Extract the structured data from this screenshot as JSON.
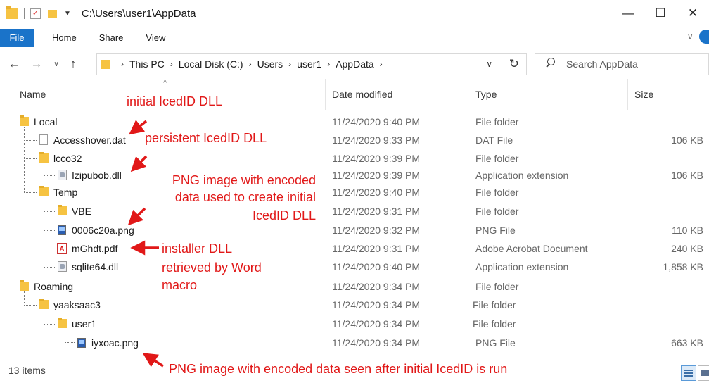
{
  "window": {
    "title": "C:\\Users\\user1\\AppData",
    "minimize": "—",
    "maximize": "☐",
    "close": "✕"
  },
  "ribbon": {
    "tabs": [
      "File",
      "Home",
      "Share",
      "View"
    ]
  },
  "nav": {
    "breadcrumbs": [
      "This PC",
      "Local Disk (C:)",
      "Users",
      "user1",
      "AppData"
    ],
    "search_placeholder": "Search AppData"
  },
  "columns": {
    "name": "Name",
    "date": "Date modified",
    "type": "Type",
    "size": "Size"
  },
  "rows": [
    {
      "name": "Local",
      "date": "11/24/2020 9:40 PM",
      "type": "File folder",
      "size": "",
      "icon": "folder-icon",
      "level": 0
    },
    {
      "name": "Accesshover.dat",
      "date": "11/24/2020 9:33 PM",
      "type": "DAT File",
      "size": "106 KB",
      "icon": "file-icon",
      "level": 1
    },
    {
      "name": "lcco32",
      "date": "11/24/2020 9:39 PM",
      "type": "File folder",
      "size": "",
      "icon": "folder-icon",
      "level": 1
    },
    {
      "name": "Izipubob.dll",
      "date": "11/24/2020 9:39 PM",
      "type": "Application extension",
      "size": "106 KB",
      "icon": "dll-icon",
      "level": 2
    },
    {
      "name": "Temp",
      "date": "11/24/2020 9:40 PM",
      "type": "File folder",
      "size": "",
      "icon": "folder-icon",
      "level": 1
    },
    {
      "name": "VBE",
      "date": "11/24/2020 9:31 PM",
      "type": "File folder",
      "size": "",
      "icon": "folder-icon",
      "level": 2
    },
    {
      "name": "0006c20a.png",
      "date": "11/24/2020 9:32 PM",
      "type": "PNG File",
      "size": "110 KB",
      "icon": "png-icon",
      "level": 2
    },
    {
      "name": "mGhdt.pdf",
      "date": "11/24/2020 9:31 PM",
      "type": "Adobe Acrobat Document",
      "size": "240 KB",
      "icon": "pdf-icon",
      "level": 2
    },
    {
      "name": "sqlite64.dll",
      "date": "11/24/2020 9:40 PM",
      "type": "Application extension",
      "size": "1,858 KB",
      "icon": "dll-icon",
      "level": 2
    },
    {
      "name": "Roaming",
      "date": "11/24/2020 9:34 PM",
      "type": "File folder",
      "size": "",
      "icon": "folder-icon",
      "level": 0
    },
    {
      "name": "yaaksaac3",
      "date": "11/24/2020 9:34 PM",
      "type": "File folder",
      "size": "",
      "icon": "folder-icon",
      "level": 1
    },
    {
      "name": "user1",
      "date": "11/24/2020 9:34 PM",
      "type": "File folder",
      "size": "",
      "icon": "folder-icon",
      "level": 2
    },
    {
      "name": "iyxoac.png",
      "date": "11/24/2020 9:34 PM",
      "type": "PNG File",
      "size": "663 KB",
      "icon": "png-icon",
      "level": 3
    }
  ],
  "annotations": {
    "initial_dll": "initial IcedID DLL",
    "persistent_dll": "persistent IcedID DLL",
    "png_line1": "PNG image with encoded",
    "png_line2": "data used to create initial",
    "png_line3": "IcedID DLL",
    "installer_line1": "installer DLL",
    "installer_line2": "retrieved by Word",
    "installer_line3": "macro",
    "bottom_png": "PNG image with encoded data seen after initial IcedID is run"
  },
  "status": {
    "items": "13 items"
  },
  "colors": {
    "annotation": "#e11818",
    "accent": "#1a73c9",
    "folder": "#f6c342"
  }
}
